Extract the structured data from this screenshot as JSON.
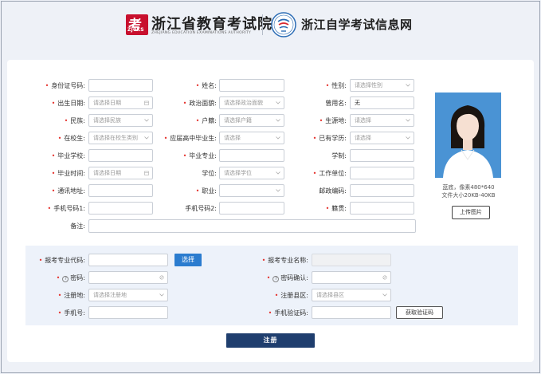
{
  "header": {
    "logo1_glyph": "考",
    "logo1_num": "ZJ0KS",
    "title": "浙江省教育考试院",
    "subtitle": "ZHEJIANG EDUCATION EXAMINATIONS AUTHORITY",
    "site_title": "浙江自学考试信息网"
  },
  "form": {
    "id_number": {
      "label": "身份证号码:",
      "required": true,
      "value": ""
    },
    "name": {
      "label": "姓名:",
      "required": true,
      "value": ""
    },
    "gender": {
      "label": "性别:",
      "required": true,
      "placeholder": "请选择性别"
    },
    "birth_date": {
      "label": "出生日期:",
      "required": true,
      "placeholder": "请选择日期"
    },
    "political": {
      "label": "政治面貌:",
      "required": true,
      "placeholder": "请选择政治面貌"
    },
    "former_name": {
      "label": "曾用名:",
      "required": false,
      "value": "无"
    },
    "ethnicity": {
      "label": "民族:",
      "required": true,
      "placeholder": "请选择民族"
    },
    "household": {
      "label": "户籍:",
      "required": true,
      "placeholder": "请选择户籍"
    },
    "origin": {
      "label": "生源地:",
      "required": true,
      "placeholder": "请选择"
    },
    "in_school": {
      "label": "在校生:",
      "required": true,
      "placeholder": "请选择在校生类别"
    },
    "hs_grad": {
      "label": "应届高中毕业生:",
      "required": true,
      "placeholder": "请选择"
    },
    "education": {
      "label": "已有学历:",
      "required": true,
      "placeholder": "请选择"
    },
    "grad_school": {
      "label": "毕业学校:",
      "required": true,
      "value": ""
    },
    "grad_major": {
      "label": "毕业专业:",
      "required": true,
      "value": ""
    },
    "study_length": {
      "label": "学制:",
      "required": false,
      "value": ""
    },
    "grad_time": {
      "label": "毕业时间:",
      "required": true,
      "placeholder": "请选择日期"
    },
    "degree": {
      "label": "学位:",
      "required": false,
      "placeholder": "请选择学位"
    },
    "work_unit": {
      "label": "工作单位:",
      "required": true,
      "value": ""
    },
    "address": {
      "label": "通讯地址:",
      "required": true,
      "value": ""
    },
    "occupation": {
      "label": "职业:",
      "required": true,
      "value": ""
    },
    "postcode": {
      "label": "邮政编码:",
      "required": false,
      "value": ""
    },
    "phone1": {
      "label": "手机号码1:",
      "required": true,
      "value": ""
    },
    "phone2": {
      "label": "手机号码2:",
      "required": false,
      "value": ""
    },
    "native_place": {
      "label": "籍贯:",
      "required": true,
      "value": ""
    },
    "remark": {
      "label": "备注:",
      "required": false,
      "value": ""
    }
  },
  "photo": {
    "caption_line1": "蓝底，像素480*640",
    "caption_line2": "文件大小20KB-40KB",
    "upload_label": "上传图片"
  },
  "register": {
    "major_code": {
      "label": "报考专业代码:",
      "required": true,
      "value": ""
    },
    "select_label": "选择",
    "major_name": {
      "label": "报考专业名称:",
      "required": true,
      "value": ""
    },
    "password": {
      "label": "密码:",
      "required": true,
      "value": ""
    },
    "password_confirm": {
      "label": "密码确认:",
      "required": true,
      "value": ""
    },
    "reg_place": {
      "label": "注册地:",
      "required": true,
      "placeholder": "请选择注册地"
    },
    "reg_county": {
      "label": "注册县区:",
      "required": true,
      "placeholder": "请选择县区"
    },
    "phone": {
      "label": "手机号:",
      "required": true,
      "value": ""
    },
    "sms_code": {
      "label": "手机验证码:",
      "required": true,
      "value": ""
    },
    "get_code_label": "获取验证码",
    "submit_label": "注册"
  },
  "icons": {
    "calendar": "calendar-icon",
    "chevron": "chevron-down-icon",
    "eye": "eye-icon",
    "help": "help-icon"
  },
  "colors": {
    "required": "#e5322d",
    "primary": "#2b7ccf",
    "submit": "#1f3e6e",
    "photo_bg": "#4a93d4",
    "logo_red": "#c8102e"
  }
}
